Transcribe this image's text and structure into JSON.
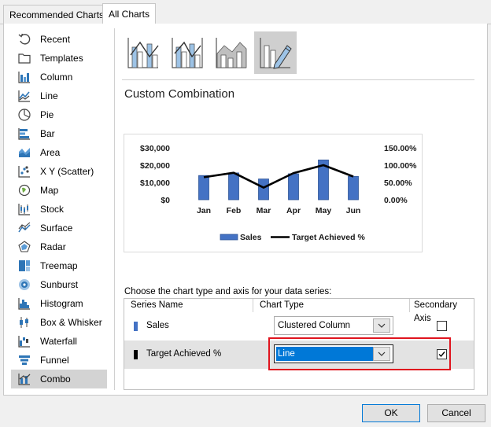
{
  "tabs": [
    {
      "label": "Recommended Charts",
      "active": false
    },
    {
      "label": "All Charts",
      "active": true
    }
  ],
  "sidebar": {
    "items": [
      {
        "label": "Recent",
        "icon": "recent-icon"
      },
      {
        "label": "Templates",
        "icon": "templates-icon"
      },
      {
        "label": "Column",
        "icon": "column-chart-icon"
      },
      {
        "label": "Line",
        "icon": "line-chart-icon"
      },
      {
        "label": "Pie",
        "icon": "pie-chart-icon"
      },
      {
        "label": "Bar",
        "icon": "bar-chart-icon"
      },
      {
        "label": "Area",
        "icon": "area-chart-icon"
      },
      {
        "label": "X Y (Scatter)",
        "icon": "scatter-chart-icon"
      },
      {
        "label": "Map",
        "icon": "map-chart-icon"
      },
      {
        "label": "Stock",
        "icon": "stock-chart-icon"
      },
      {
        "label": "Surface",
        "icon": "surface-chart-icon"
      },
      {
        "label": "Radar",
        "icon": "radar-chart-icon"
      },
      {
        "label": "Treemap",
        "icon": "treemap-chart-icon"
      },
      {
        "label": "Sunburst",
        "icon": "sunburst-chart-icon"
      },
      {
        "label": "Histogram",
        "icon": "histogram-chart-icon"
      },
      {
        "label": "Box & Whisker",
        "icon": "box-whisker-chart-icon"
      },
      {
        "label": "Waterfall",
        "icon": "waterfall-chart-icon"
      },
      {
        "label": "Funnel",
        "icon": "funnel-chart-icon"
      },
      {
        "label": "Combo",
        "icon": "combo-chart-icon",
        "selected": true
      }
    ]
  },
  "subtypes": [
    {
      "icon": "clustered-column-line-icon",
      "selected": false
    },
    {
      "icon": "clustered-column-line-secondary-axis-icon",
      "selected": false
    },
    {
      "icon": "stacked-area-clustered-column-icon",
      "selected": false
    },
    {
      "icon": "custom-combination-icon",
      "selected": true
    }
  ],
  "main": {
    "title": "Custom Combination",
    "choose_label": "Choose the chart type and axis for your data series:"
  },
  "chart_data": {
    "type": "bar",
    "categories": [
      "Jan",
      "Feb",
      "Mar",
      "Apr",
      "May",
      "Jun"
    ],
    "series": [
      {
        "name": "Sales",
        "type": "bar",
        "axis": "primary",
        "color": "#4472c4",
        "values": [
          14000,
          15500,
          12000,
          15000,
          23000,
          13500
        ]
      },
      {
        "name": "Target Achieved %",
        "type": "line",
        "axis": "secondary",
        "color": "#000000",
        "values": [
          0.65,
          0.78,
          0.35,
          0.77,
          1.0,
          0.67
        ]
      }
    ],
    "y_ticks": [
      "$30,000",
      "$20,000",
      "$10,000",
      "$0"
    ],
    "y_max": 30000,
    "y2_ticks": [
      "150.00%",
      "100.00%",
      "50.00%",
      "0.00%"
    ],
    "y2_max": 1.5,
    "legend": [
      "Sales",
      "Target Achieved %"
    ],
    "legend_position": "bottom",
    "grid": false
  },
  "series_grid": {
    "headers": {
      "name": "Series Name",
      "type": "Chart Type",
      "axis": "Secondary Axis"
    },
    "rows": [
      {
        "name": "Sales",
        "chart_type": "Clustered Column",
        "secondary_axis": false,
        "color": "#4472c4",
        "highlighted": false
      },
      {
        "name": "Target Achieved %",
        "chart_type": "Line",
        "secondary_axis": true,
        "color": "#000000",
        "highlighted": true
      }
    ]
  },
  "buttons": {
    "ok": "OK",
    "cancel": "Cancel"
  },
  "colors": {
    "accent": "#0078d7",
    "highlight_box": "#e0141e",
    "series_blue": "#4472c4"
  }
}
